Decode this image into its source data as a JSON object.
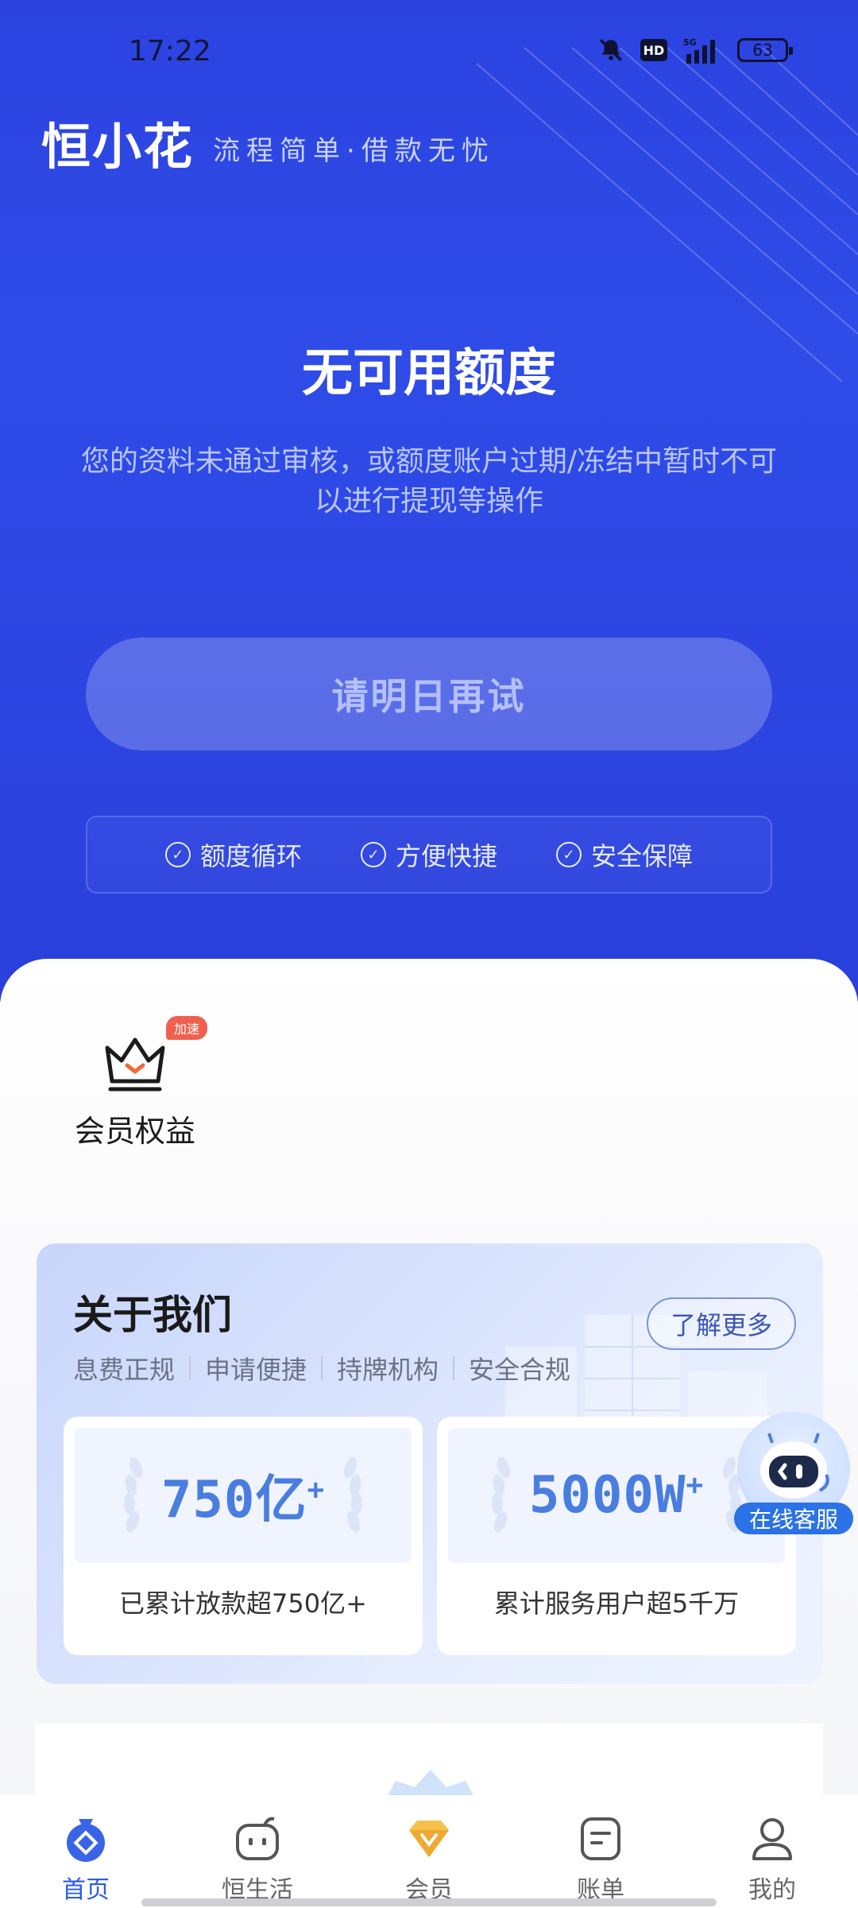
{
  "status_bar": {
    "time": "17:22",
    "network": "5G",
    "hd": "HD",
    "battery": "63"
  },
  "brand": {
    "logo": "恒小花",
    "slogan": "流程简单·借款无忧"
  },
  "hero": {
    "title": "无可用额度",
    "description": "您的资料未通过审核，或额度账户过期/冻结中暂时不可以进行提现等操作",
    "retry_button": "请明日再试",
    "features": [
      "额度循环",
      "方便快捷",
      "安全保障"
    ]
  },
  "vip": {
    "tag": "加速",
    "label": "会员权益"
  },
  "about": {
    "title": "关于我们",
    "more_button": "了解更多",
    "tags": [
      "息费正规",
      "申请便捷",
      "持牌机构",
      "安全合规"
    ],
    "stats": [
      {
        "value": "750亿",
        "suffix": "+",
        "caption": "已累计放款超750亿+"
      },
      {
        "value": "5000W",
        "suffix": "+",
        "caption": "累计服务用户超5千万"
      }
    ]
  },
  "customer_service": {
    "label": "在线客服"
  },
  "tabbar": {
    "tabs": [
      {
        "label": "首页",
        "icon": "home-icon",
        "active": true
      },
      {
        "label": "恒生活",
        "icon": "life-icon",
        "active": false
      },
      {
        "label": "会员",
        "icon": "vip-diamond-icon",
        "active": false
      },
      {
        "label": "账单",
        "icon": "bill-icon",
        "active": false
      },
      {
        "label": "我的",
        "icon": "profile-icon",
        "active": false
      }
    ]
  },
  "colors": {
    "primary_blue": "#2c43e0",
    "tab_active": "#2a5ce6",
    "stat_blue": "#4a7de0"
  }
}
